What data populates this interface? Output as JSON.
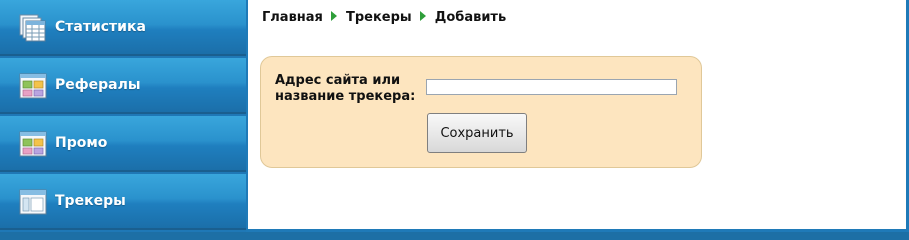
{
  "sidebar": {
    "items": [
      {
        "label": "Статистика",
        "icon": "stats-sheets-icon"
      },
      {
        "label": "Рефералы",
        "icon": "referrals-grid-icon"
      },
      {
        "label": "Промо",
        "icon": "promo-grid-icon"
      },
      {
        "label": "Трекеры",
        "icon": "trackers-window-icon"
      }
    ]
  },
  "breadcrumb": {
    "items": [
      "Главная",
      "Трекеры",
      "Добавить"
    ],
    "separator_icon": "green-triangle-arrow-icon",
    "separator_color": "#2e9e3a"
  },
  "form": {
    "field_label": "Адрес сайта или название трекера:",
    "field_value": "",
    "save_label": "Сохранить"
  },
  "colors": {
    "sidebar_blue": "#2a92cd",
    "panel_bg": "#fde5bf"
  }
}
